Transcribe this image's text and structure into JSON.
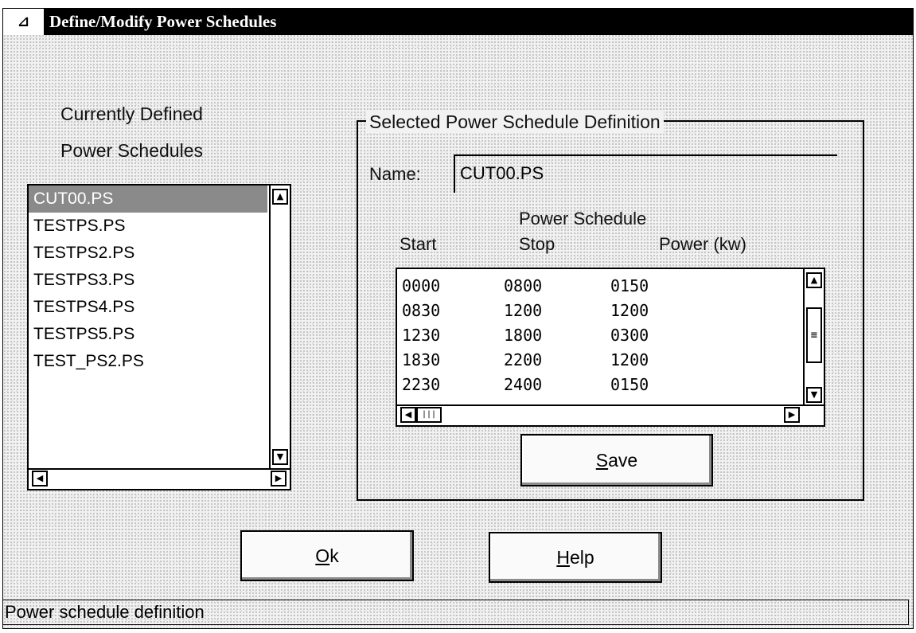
{
  "window": {
    "title": "Define/Modify Power Schedules",
    "system_menu_icon": "system-menu-icon",
    "system_menu_glyph": "⊿"
  },
  "left_panel": {
    "label_line1": "Currently Defined",
    "label_line2": "Power Schedules",
    "items": [
      {
        "label": "CUT00.PS",
        "selected": true
      },
      {
        "label": "TESTPS.PS",
        "selected": false
      },
      {
        "label": "TESTPS2.PS",
        "selected": false
      },
      {
        "label": "TESTPS3.PS",
        "selected": false
      },
      {
        "label": "TESTPS4.PS",
        "selected": false
      },
      {
        "label": "TESTPS5.PS",
        "selected": false
      },
      {
        "label": "TEST_PS2.PS",
        "selected": false
      }
    ]
  },
  "definition": {
    "group_title": "Selected Power Schedule Definition",
    "name_label": "Name:",
    "name_value": "CUT00.PS",
    "schedule_heading": "Power Schedule",
    "columns": [
      "Start",
      "Stop",
      "Power (kw)"
    ],
    "rows": [
      [
        "0000",
        "0800",
        "0150"
      ],
      [
        "0830",
        "1200",
        "1200"
      ],
      [
        "1230",
        "1800",
        "0300"
      ],
      [
        "1830",
        "2200",
        "1200"
      ],
      [
        "2230",
        "2400",
        "0150"
      ]
    ],
    "save_button": {
      "mnemonic": "S",
      "rest": "ave"
    }
  },
  "buttons": {
    "ok": {
      "mnemonic": "O",
      "rest": "k"
    },
    "help": {
      "mnemonic": "H",
      "rest": "elp"
    }
  },
  "status": {
    "text": "Power schedule definition"
  },
  "icons": {
    "scroll_up": "▲",
    "scroll_down": "▼",
    "scroll_left": "◀",
    "scroll_right": "▶",
    "thumb_vertical": "≡",
    "thumb_horizontal": "|||"
  }
}
